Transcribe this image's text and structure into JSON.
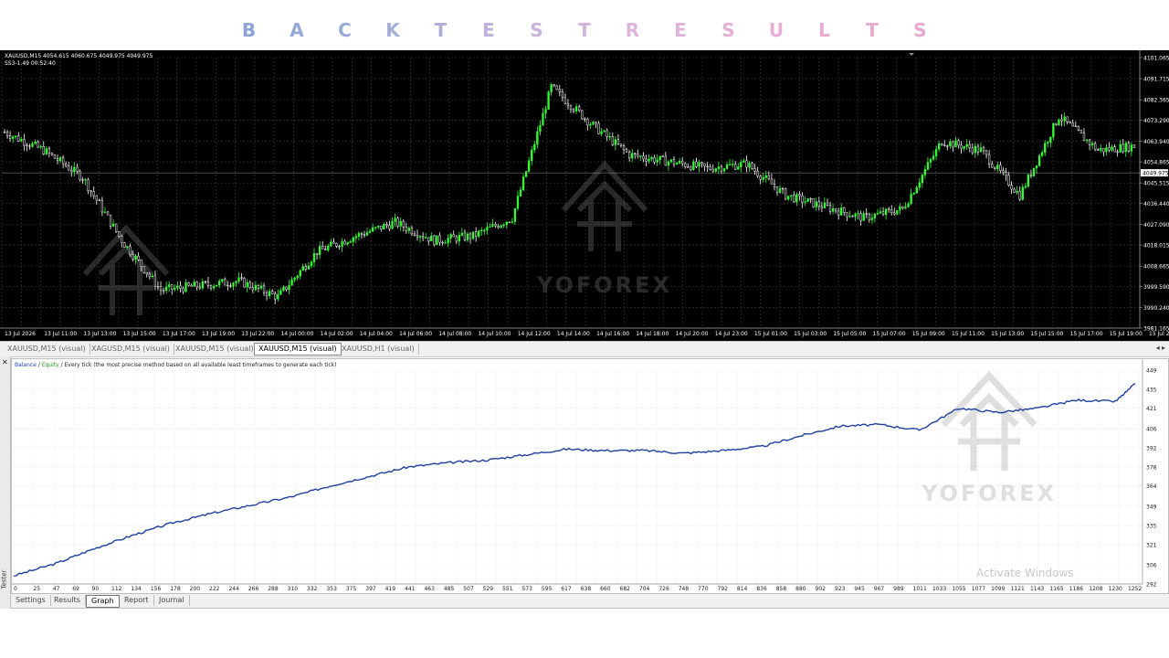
{
  "title_letters": [
    "B",
    "A",
    "C",
    "K",
    "T",
    "E",
    "S",
    "T",
    "R",
    "E",
    "S",
    "U",
    "L",
    "T",
    "S"
  ],
  "title_colors": [
    "#8aa3d4",
    "#96a8d6",
    "#9aaad8",
    "#a6acd9",
    "#b0aed9",
    "#beb0da",
    "#c8b2dc",
    "#d2b4dc",
    "#dcb6dc",
    "#e0b4da",
    "#e4b0d6",
    "#e6aed4",
    "#e8acd2",
    "#e8a9cf",
    "#e8a6cc"
  ],
  "price_header": {
    "line1": "XAUUSD,M15  4054.615 4060.675 4049.975 4049.975",
    "line2": "SS3-1.49     00:52:40"
  },
  "price_axis_labels": [
    "4101.065",
    "4091.715",
    "4082.365",
    "4073.290",
    "4063.940",
    "4054.865",
    "4045.515",
    "4036.440",
    "4027.090",
    "4018.015",
    "4008.665",
    "3999.590",
    "3990.240",
    "3981.165"
  ],
  "current_price_label": "4049.975",
  "time_labels": [
    "13 Jul 2026",
    "13 Jul 11:00",
    "13 Jul 13:00",
    "13 Jul 15:00",
    "13 Jul 17:00",
    "13 Jul 19:00",
    "13 Jul 22:00",
    "14 Jul 00:00",
    "14 Jul 02:00",
    "14 Jul 04:00",
    "14 Jul 06:00",
    "14 Jul 08:00",
    "14 Jul 10:00",
    "14 Jul 12:00",
    "14 Jul 14:00",
    "14 Jul 16:00",
    "14 Jul 18:00",
    "14 Jul 20:00",
    "14 Jul 23:00",
    "15 Jul 01:00",
    "15 Jul 03:00",
    "15 Jul 05:00",
    "15 Jul 07:00",
    "15 Jul 09:00",
    "15 Jul 11:00",
    "15 Jul 13:00",
    "15 Jul 15:00",
    "15 Jul 17:00",
    "15 Jul 19:00",
    "15 Jul 22:00"
  ],
  "chart_tabs": [
    {
      "label": "XAUUSD,M15 (visual)",
      "active": false
    },
    {
      "label": "XAGUSD,M15 (visual)",
      "active": false
    },
    {
      "label": "XAUUSD,M15 (visual)",
      "active": false
    },
    {
      "label": "XAUUSD,M15 (visual)",
      "active": true
    },
    {
      "label": "XAUUSD,H1 (visual)",
      "active": false
    }
  ],
  "watermark_text": "YOFOREX",
  "legend": {
    "balance": "Balance",
    "sep": " / ",
    "equity": "Equity",
    "rest": " / Every tick (the most precise method based on all available least timeframes to generate each tick)"
  },
  "graph_y_labels": [
    "449",
    "435",
    "421",
    "406",
    "392",
    "378",
    "364",
    "349",
    "335",
    "321",
    "306",
    "292"
  ],
  "graph_x_labels": [
    "0",
    "25",
    "47",
    "69",
    "90",
    "112",
    "134",
    "156",
    "178",
    "200",
    "222",
    "244",
    "266",
    "288",
    "310",
    "332",
    "353",
    "375",
    "397",
    "419",
    "441",
    "463",
    "485",
    "507",
    "529",
    "551",
    "573",
    "595",
    "617",
    "638",
    "660",
    "682",
    "704",
    "726",
    "748",
    "770",
    "792",
    "814",
    "836",
    "858",
    "880",
    "902",
    "923",
    "945",
    "967",
    "989",
    "1011",
    "1033",
    "1055",
    "1077",
    "1099",
    "1121",
    "1143",
    "1165",
    "1186",
    "1208",
    "1230",
    "1252"
  ],
  "activate_windows": "Activate Windows",
  "tester_label": "Tester",
  "bottom_tabs": [
    {
      "label": "Settings",
      "active": false
    },
    {
      "label": "Results",
      "active": false
    },
    {
      "label": "Graph",
      "active": true
    },
    {
      "label": "Report",
      "active": false
    },
    {
      "label": "Journal",
      "active": false
    }
  ],
  "colors": {
    "bull_candle": "#33ff33",
    "bear_candle": "#ffffff",
    "grid_dark": "#2a2a2a",
    "balance_line": "#1f3f9f"
  },
  "chart_data": [
    {
      "type": "line",
      "description_series": "price",
      "ylim": [
        3981.165,
        4101.065
      ],
      "y_ticks": [
        4101.065,
        4091.715,
        4082.365,
        4073.29,
        4063.94,
        4054.865,
        4045.515,
        4036.44,
        4027.09,
        4018.015,
        4008.665,
        3999.59,
        3990.24,
        3981.165
      ],
      "x": [
        "13 Jul 2026",
        "13 Jul 11:00",
        "13 Jul 13:00",
        "13 Jul 15:00",
        "13 Jul 17:00",
        "13 Jul 19:00",
        "13 Jul 22:00",
        "14 Jul 00:00",
        "14 Jul 02:00",
        "14 Jul 04:00",
        "14 Jul 06:00",
        "14 Jul 08:00",
        "14 Jul 10:00",
        "14 Jul 12:00",
        "14 Jul 14:00",
        "14 Jul 16:00",
        "14 Jul 18:00",
        "14 Jul 20:00",
        "14 Jul 23:00",
        "15 Jul 01:00",
        "15 Jul 03:00",
        "15 Jul 05:00",
        "15 Jul 07:00",
        "15 Jul 09:00",
        "15 Jul 11:00",
        "15 Jul 13:00",
        "15 Jul 15:00",
        "15 Jul 17:00",
        "15 Jul 19:00",
        "15 Jul 22:00"
      ],
      "values": [
        4068,
        4060,
        4048,
        4020,
        3998,
        4000,
        4002,
        3995,
        4015,
        4022,
        4028,
        4020,
        4022,
        4030,
        4088,
        4072,
        4058,
        4055,
        4052,
        4054,
        4040,
        4035,
        4030,
        4034,
        4064,
        4060,
        4040,
        4075,
        4060,
        4062
      ],
      "grid": true
    },
    {
      "type": "line",
      "series": [
        {
          "name": "Balance",
          "values": [
            298,
            307,
            318,
            328,
            337,
            344,
            350,
            356,
            364,
            371,
            378,
            381,
            383,
            387,
            391,
            390,
            390,
            388,
            390,
            393,
            401,
            408,
            409,
            405,
            421,
            418,
            421,
            427,
            426,
            439
          ]
        }
      ],
      "x": [
        0,
        47,
        90,
        134,
        178,
        222,
        266,
        310,
        353,
        397,
        441,
        485,
        529,
        573,
        617,
        660,
        704,
        748,
        792,
        836,
        880,
        923,
        967,
        1011,
        1055,
        1099,
        1143,
        1186,
        1230,
        1252
      ],
      "ylim": [
        292,
        449
      ],
      "grid": true
    }
  ]
}
